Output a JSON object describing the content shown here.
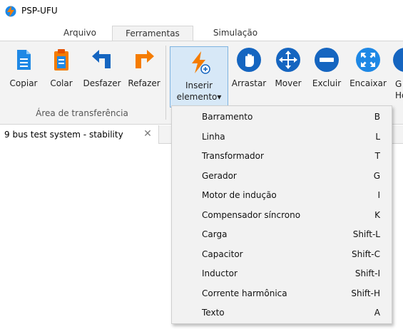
{
  "app": {
    "title": "PSP-UFU"
  },
  "tabs": [
    {
      "label": "Arquivo"
    },
    {
      "label": "Ferramentas"
    },
    {
      "label": "Simulação"
    }
  ],
  "ribbon": {
    "buttons": [
      {
        "label": "Copiar",
        "icon": "copy-icon"
      },
      {
        "label": "Colar",
        "icon": "paste-icon"
      },
      {
        "label": "Desfazer",
        "icon": "undo-icon"
      },
      {
        "label": "Refazer",
        "icon": "redo-icon"
      },
      {
        "label_line1": "Inserir",
        "label_line2": "elemento▾",
        "icon": "insert-element-icon"
      },
      {
        "label": "Arrastar",
        "icon": "drag-hand-icon"
      },
      {
        "label": "Mover",
        "icon": "move-arrows-icon"
      },
      {
        "label": "Excluir",
        "icon": "delete-icon"
      },
      {
        "label": "Encaixar",
        "icon": "fit-icon"
      },
      {
        "label_line1": "G",
        "label_line2": "Ho",
        "icon": "partial-icon"
      }
    ],
    "group_label": "Área de transferência"
  },
  "document": {
    "tab_name": "9 bus test system - stability",
    "close_glyph": "✕"
  },
  "menu": {
    "items": [
      {
        "label": "Barramento",
        "shortcut": "B"
      },
      {
        "label": "Linha",
        "shortcut": "L"
      },
      {
        "label": "Transformador",
        "shortcut": "T"
      },
      {
        "label": "Gerador",
        "shortcut": "G"
      },
      {
        "label": "Motor de indução",
        "shortcut": "I"
      },
      {
        "label": "Compensador síncrono",
        "shortcut": "K"
      },
      {
        "label": "Carga",
        "shortcut": "Shift-L"
      },
      {
        "label": "Capacitor",
        "shortcut": "Shift-C"
      },
      {
        "label": "Inductor",
        "shortcut": "Shift-I"
      },
      {
        "label": "Corrente harmônica",
        "shortcut": "Shift-H"
      },
      {
        "label": "Texto",
        "shortcut": "A"
      }
    ]
  },
  "colors": {
    "accent_blue": "#1e88e5",
    "accent_orange": "#f57c00",
    "icon_dark_blue": "#1565c0"
  }
}
